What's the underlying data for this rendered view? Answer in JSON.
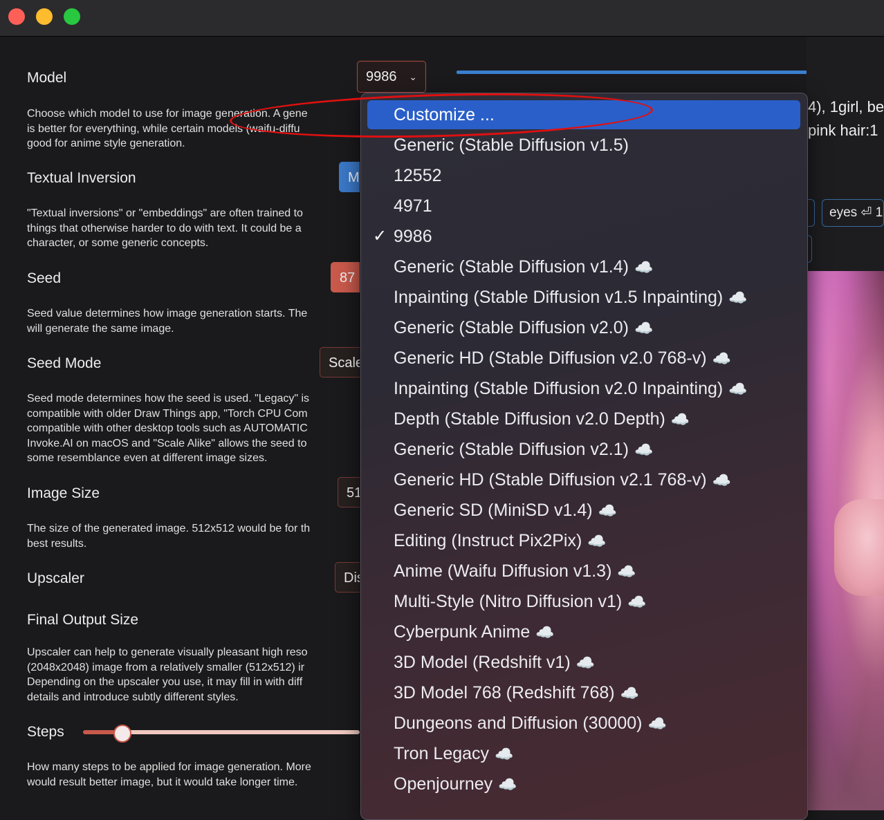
{
  "window": {
    "traffic_lights": [
      "close",
      "minimize",
      "zoom"
    ]
  },
  "settings": {
    "model": {
      "label": "Model",
      "value": "9986",
      "desc": [
        "Choose which model to use for image generation. A gene",
        "is better for everything, while certain models (waifu-diffu",
        "good for anime style generation."
      ]
    },
    "textual_inversion": {
      "label": "Textual Inversion",
      "value": "M",
      "desc": [
        "\"Textual inversions\" or \"embeddings\" are often trained to",
        "things that otherwise harder to do with text. It could be a",
        "character, or some generic concepts."
      ]
    },
    "seed": {
      "label": "Seed",
      "value": "87",
      "desc": [
        "Seed value determines how image generation starts. The",
        "will generate the same image."
      ]
    },
    "seed_mode": {
      "label": "Seed Mode",
      "value": "Scale",
      "desc": [
        "Seed mode determines how the seed is used. \"Legacy\" is",
        "compatible with older Draw Things app, \"Torch CPU Com",
        "compatible with other desktop tools such as AUTOMATIC",
        "Invoke.AI on macOS and \"Scale Alike\" allows the seed to",
        "some resemblance even at different image sizes."
      ]
    },
    "image_size": {
      "label": "Image Size",
      "value": "51",
      "desc": [
        "The size of the generated image. 512x512 would be for th",
        "best results."
      ]
    },
    "upscaler": {
      "label": "Upscaler",
      "value": "Dis"
    },
    "final_output_size": {
      "label": "Final Output Size",
      "desc": [
        "Upscaler can help to generate visually pleasant high reso",
        "(2048x2048) image from a relatively smaller (512x512) ir",
        "Depending on the upscaler you use, it may fill in with diff",
        "details and introduce subtly different styles."
      ]
    },
    "steps": {
      "label": "Steps",
      "value_fraction": 0.14,
      "desc": [
        "How many steps to be applied for image generation. More",
        "would result better image, but it would take longer time."
      ]
    }
  },
  "prompt": {
    "line1": "4), 1girl, be",
    "line2": "pink hair:1",
    "chip_eyes": "eyes ⏎ 1"
  },
  "dropdown": {
    "items": [
      {
        "label": "Customize ...",
        "highlighted": true
      },
      {
        "label": "Generic (Stable Diffusion v1.5)"
      },
      {
        "label": "12552"
      },
      {
        "label": "4971"
      },
      {
        "label": "9986",
        "checked": true
      },
      {
        "label": "Generic (Stable Diffusion v1.4)",
        "cloud": true
      },
      {
        "label": "Inpainting (Stable Diffusion v1.5 Inpainting)",
        "cloud": true
      },
      {
        "label": "Generic (Stable Diffusion v2.0)",
        "cloud": true
      },
      {
        "label": "Generic HD (Stable Diffusion v2.0 768-v)",
        "cloud": true
      },
      {
        "label": "Inpainting (Stable Diffusion v2.0 Inpainting)",
        "cloud": true
      },
      {
        "label": "Depth (Stable Diffusion v2.0 Depth)",
        "cloud": true
      },
      {
        "label": "Generic (Stable Diffusion v2.1)",
        "cloud": true
      },
      {
        "label": "Generic HD (Stable Diffusion v2.1 768-v)",
        "cloud": true
      },
      {
        "label": "Generic SD (MiniSD v1.4)",
        "cloud": true
      },
      {
        "label": "Editing (Instruct Pix2Pix)",
        "cloud": true
      },
      {
        "label": "Anime (Waifu Diffusion v1.3)",
        "cloud": true
      },
      {
        "label": "Multi-Style (Nitro Diffusion v1)",
        "cloud": true
      },
      {
        "label": "Cyberpunk Anime",
        "cloud": true
      },
      {
        "label": "3D Model (Redshift v1)",
        "cloud": true
      },
      {
        "label": "3D Model 768 (Redshift 768)",
        "cloud": true
      },
      {
        "label": "Dungeons and Diffusion (30000)",
        "cloud": true
      },
      {
        "label": "Tron Legacy",
        "cloud": true
      },
      {
        "label": "Openjourney",
        "cloud": true
      }
    ]
  },
  "icons": {
    "check": "✓",
    "cloud": "☁️",
    "chevron": "⌄"
  },
  "colors": {
    "accent_blue": "#2a5fc9",
    "accent_red": "#c8594b",
    "annotation_red": "#e01010"
  }
}
